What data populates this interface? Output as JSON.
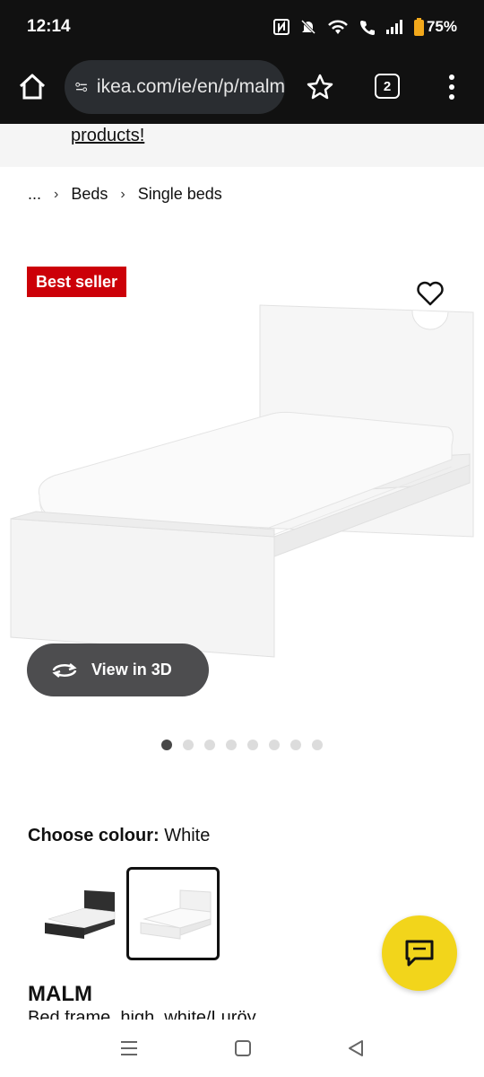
{
  "status": {
    "time": "12:14",
    "battery": "75%",
    "icons": [
      "nfc-icon",
      "mute-icon",
      "wifi-icon",
      "wifi-call-icon",
      "signal-icon",
      "battery-icon"
    ]
  },
  "browser": {
    "url": "ikea.com/ie/en/p/malm",
    "tab_count": "2"
  },
  "banner": {
    "link_text": "products!"
  },
  "breadcrumb": {
    "items": [
      "...",
      "Beds",
      "Single beds"
    ],
    "separator": "›"
  },
  "product": {
    "badge": "Best seller",
    "view_3d_label": "View in 3D",
    "image_count": 8,
    "active_image_index": 0,
    "colour_label": "Choose colour:",
    "colour_value": "White",
    "colour_options": [
      "black-brown",
      "white"
    ],
    "selected_colour": "white",
    "name": "MALM",
    "description": "Bed frame, high, white/Luröy"
  },
  "colors": {
    "badge_red": "#cc0008",
    "chat_yellow": "#f2d51b",
    "view3d_bg": "#4d4d4f"
  }
}
